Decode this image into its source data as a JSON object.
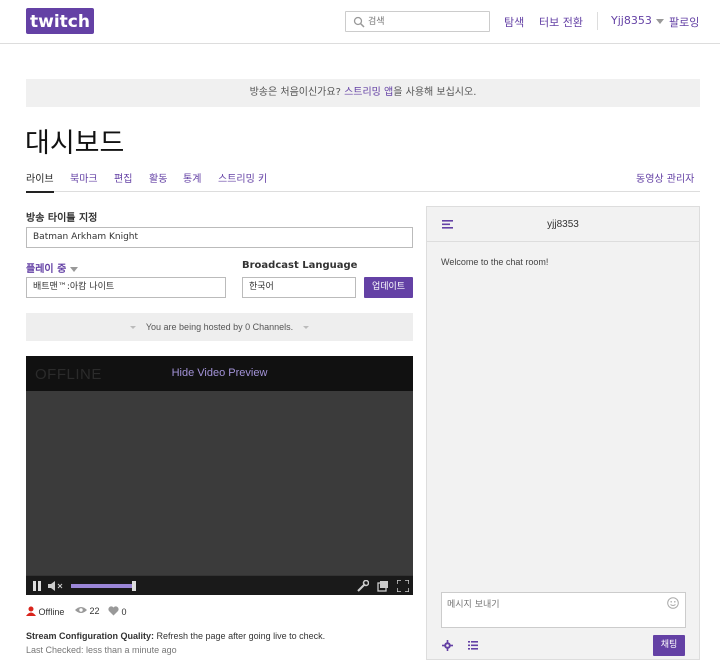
{
  "header": {
    "logo_text": "twitch",
    "search_placeholder": "검색",
    "nav": [
      "탐색",
      "터보 전환"
    ],
    "user": "Yjj8353",
    "following": "팔로잉"
  },
  "notice": {
    "before": "방송은 처음이신가요? ",
    "link": "스트리밍 앱",
    "after": "을 사용해 보십시오."
  },
  "page_title": "대시보드",
  "tabs": [
    "라이브",
    "북마크",
    "편집",
    "활동",
    "통계",
    "스트리밍 키"
  ],
  "video_manager": "동영상 관리자",
  "form": {
    "title_label": "방송 타이틀 지정",
    "title_value": "Batman Arkham Knight",
    "playing_label": "플레이 중",
    "playing_value": "배트맨™:아캄 나이트",
    "language_label": "Broadcast Language",
    "language_value": "한국어",
    "update_button": "업데이트"
  },
  "hosted_text": "You are being hosted by 0 Channels.",
  "video": {
    "offline_label": "OFFLINE",
    "hide_preview": "Hide Video Preview",
    "volume": 0.85
  },
  "stats": {
    "status": "Offline",
    "viewers": "22",
    "followers": "0"
  },
  "config": {
    "label": "Stream Configuration Quality:",
    "text": " Refresh the page after going live to check.",
    "last_checked": "Last Checked: less than a minute ago"
  },
  "chat": {
    "channel": "yjj8353",
    "welcome": "Welcome to the chat room!",
    "placeholder": "메시지 보내기",
    "send_button": "채팅"
  },
  "colors": {
    "accent": "#6441a5",
    "offline_red": "#d9241c"
  }
}
